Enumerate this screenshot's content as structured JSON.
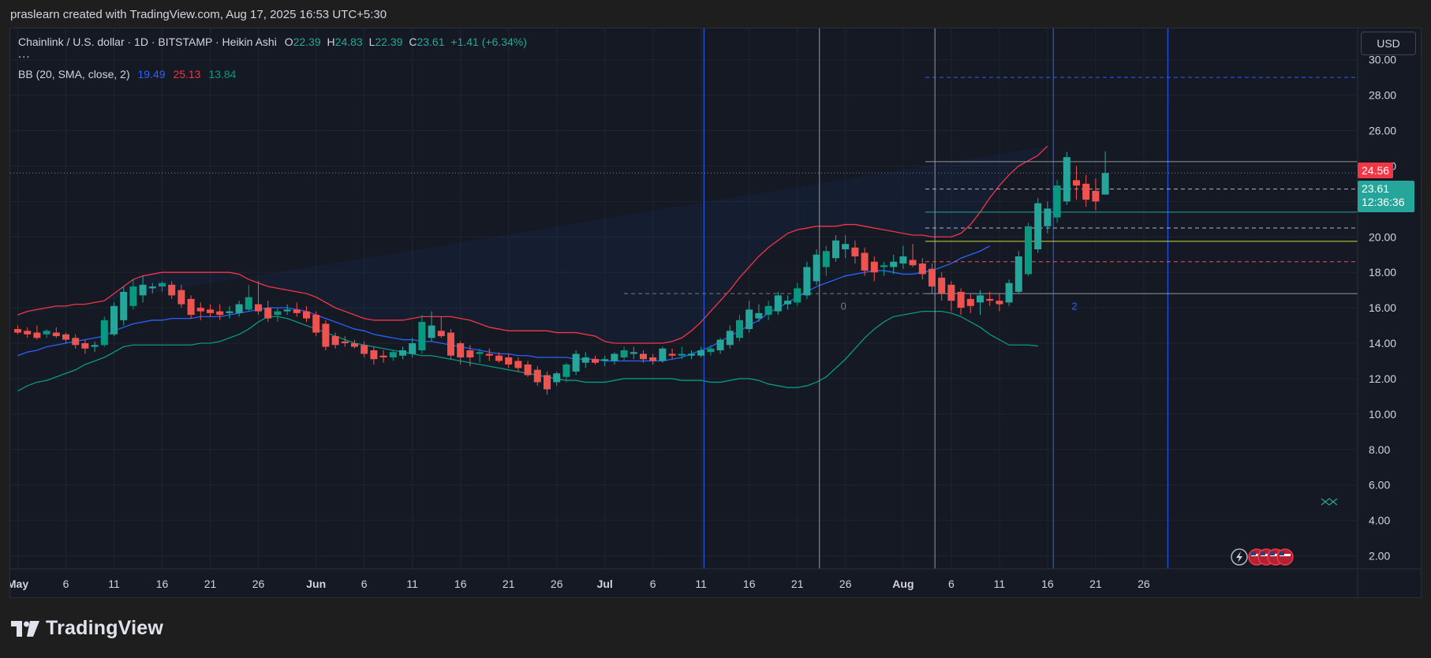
{
  "caption": "praslearn created with TradingView.com, Aug 17, 2025 16:53 UTC+5:30",
  "legend": {
    "symbol": "Chainlink / U.S. dollar · 1D · BITSTAMP · Heikin Ashi",
    "o_label": "O",
    "o": "22.39",
    "h_label": "H",
    "h": "24.83",
    "l_label": "L",
    "l": "22.39",
    "c_label": "C",
    "c": "23.61",
    "change": "+1.41 (+6.34%)",
    "more": "...",
    "bb_label": "BB (20, SMA, close, 2)",
    "bb_basis": "19.49",
    "bb_upper": "25.13",
    "bb_lower": "13.84"
  },
  "currency": "USD",
  "badges": {
    "upper": "24.56",
    "last_price": "23.61",
    "countdown": "12:36:36"
  },
  "footer": {
    "logo_text": "TradingView"
  },
  "colors": {
    "up": "#26a69a",
    "up_strong": "#089981",
    "down": "#ef5350",
    "bb_basis": "#2962ff",
    "bb_upper": "#f23645",
    "bb_lower": "#089981",
    "fill": "#2962ff"
  },
  "chart_data": {
    "type": "candlestick",
    "ylim": [
      1.0,
      31.5
    ],
    "y_ticks": [
      "30.00",
      "28.00",
      "26.00",
      "24.00",
      "22.00",
      "20.00",
      "18.00",
      "16.00",
      "14.00",
      "12.00",
      "10.00",
      "8.00",
      "6.00",
      "4.00",
      "2.00"
    ],
    "y_tick_values": [
      30,
      28,
      26,
      24,
      22,
      20,
      18,
      16,
      14,
      12,
      10,
      8,
      6,
      4,
      2
    ],
    "x_ticks": [
      {
        "label": "May",
        "day": 0
      },
      {
        "label": "6",
        "day": 5
      },
      {
        "label": "11",
        "day": 10
      },
      {
        "label": "16",
        "day": 15
      },
      {
        "label": "21",
        "day": 20
      },
      {
        "label": "26",
        "day": 25
      },
      {
        "label": "Jun",
        "day": 31
      },
      {
        "label": "6",
        "day": 36
      },
      {
        "label": "11",
        "day": 41
      },
      {
        "label": "16",
        "day": 46
      },
      {
        "label": "21",
        "day": 51
      },
      {
        "label": "26",
        "day": 56
      },
      {
        "label": "Jul",
        "day": 61
      },
      {
        "label": "6",
        "day": 66
      },
      {
        "label": "11",
        "day": 71
      },
      {
        "label": "16",
        "day": 76
      },
      {
        "label": "21",
        "day": 81
      },
      {
        "label": "26",
        "day": 86
      },
      {
        "label": "Aug",
        "day": 92
      },
      {
        "label": "6",
        "day": 97
      },
      {
        "label": "11",
        "day": 102
      },
      {
        "label": "16",
        "day": 107
      },
      {
        "label": "21",
        "day": 112
      },
      {
        "label": "26",
        "day": 117
      }
    ],
    "candles_ohlc": [
      [
        14.8,
        15.0,
        14.5,
        14.6
      ],
      [
        14.7,
        14.9,
        14.3,
        14.5
      ],
      [
        14.6,
        15.0,
        14.2,
        14.3
      ],
      [
        14.5,
        14.8,
        14.3,
        14.7
      ],
      [
        14.6,
        14.9,
        14.3,
        14.4
      ],
      [
        14.5,
        14.6,
        14.0,
        14.2
      ],
      [
        14.3,
        14.5,
        13.7,
        13.9
      ],
      [
        14.0,
        14.2,
        13.4,
        13.7
      ],
      [
        13.8,
        14.1,
        13.5,
        13.9
      ],
      [
        13.9,
        15.5,
        13.8,
        15.3
      ],
      [
        14.5,
        16.3,
        14.4,
        16.1
      ],
      [
        15.3,
        17.2,
        15.0,
        16.9
      ],
      [
        16.1,
        17.6,
        15.9,
        17.2
      ],
      [
        16.7,
        17.8,
        16.3,
        17.3
      ],
      [
        17.1,
        17.4,
        16.8,
        17.2
      ],
      [
        17.2,
        17.5,
        16.9,
        17.4
      ],
      [
        17.3,
        17.5,
        16.5,
        16.7
      ],
      [
        17.0,
        17.3,
        16.0,
        16.2
      ],
      [
        16.5,
        16.7,
        15.4,
        15.6
      ],
      [
        16.0,
        16.3,
        15.3,
        15.8
      ],
      [
        15.9,
        16.2,
        15.5,
        15.7
      ],
      [
        15.8,
        16.2,
        15.3,
        15.6
      ],
      [
        15.7,
        16.1,
        15.4,
        15.8
      ],
      [
        15.7,
        16.4,
        15.5,
        16.2
      ],
      [
        15.9,
        17.3,
        15.8,
        16.6
      ],
      [
        16.2,
        17.5,
        15.6,
        15.8
      ],
      [
        16.0,
        16.4,
        15.2,
        15.4
      ],
      [
        15.6,
        16.0,
        15.2,
        15.8
      ],
      [
        15.8,
        16.2,
        15.6,
        15.9
      ],
      [
        15.9,
        16.3,
        15.5,
        15.7
      ],
      [
        15.8,
        16.1,
        15.2,
        15.4
      ],
      [
        15.6,
        15.8,
        14.4,
        14.6
      ],
      [
        15.1,
        15.3,
        13.6,
        13.8
      ],
      [
        14.4,
        14.6,
        13.7,
        13.9
      ],
      [
        14.1,
        14.4,
        13.8,
        14.0
      ],
      [
        14.0,
        14.2,
        13.7,
        13.8
      ],
      [
        13.9,
        14.1,
        13.2,
        13.4
      ],
      [
        13.6,
        13.8,
        12.8,
        13.1
      ],
      [
        13.3,
        13.6,
        12.9,
        13.2
      ],
      [
        13.2,
        13.6,
        13.0,
        13.5
      ],
      [
        13.3,
        13.8,
        13.1,
        13.6
      ],
      [
        13.4,
        14.3,
        13.2,
        14.0
      ],
      [
        13.6,
        15.6,
        13.4,
        15.2
      ],
      [
        14.3,
        15.8,
        14.1,
        15.0
      ],
      [
        14.7,
        15.5,
        14.3,
        14.4
      ],
      [
        14.6,
        14.8,
        13.1,
        13.3
      ],
      [
        14.0,
        14.1,
        12.8,
        13.2
      ],
      [
        13.6,
        13.9,
        12.7,
        13.2
      ],
      [
        13.4,
        13.7,
        12.9,
        13.5
      ],
      [
        13.4,
        13.7,
        13.0,
        13.3
      ],
      [
        13.3,
        13.5,
        12.9,
        13.0
      ],
      [
        13.2,
        13.4,
        12.6,
        12.8
      ],
      [
        13.0,
        13.2,
        12.4,
        12.6
      ],
      [
        12.8,
        13.0,
        12.1,
        12.2
      ],
      [
        12.5,
        12.7,
        11.6,
        11.8
      ],
      [
        12.2,
        12.4,
        11.1,
        11.4
      ],
      [
        11.8,
        12.4,
        11.6,
        12.3
      ],
      [
        12.1,
        12.9,
        11.8,
        12.8
      ],
      [
        12.4,
        13.6,
        12.2,
        13.4
      ],
      [
        12.9,
        13.5,
        12.6,
        13.2
      ],
      [
        13.1,
        13.3,
        12.8,
        12.9
      ],
      [
        13.0,
        13.3,
        12.7,
        13.1
      ],
      [
        13.0,
        13.5,
        12.8,
        13.4
      ],
      [
        13.2,
        13.8,
        13.0,
        13.6
      ],
      [
        13.4,
        13.8,
        13.1,
        13.5
      ],
      [
        13.4,
        13.6,
        12.9,
        13.1
      ],
      [
        13.2,
        13.4,
        12.8,
        13.0
      ],
      [
        13.0,
        13.8,
        12.9,
        13.7
      ],
      [
        13.4,
        13.7,
        13.1,
        13.3
      ],
      [
        13.3,
        13.8,
        13.1,
        13.4
      ],
      [
        13.3,
        13.6,
        13.1,
        13.4
      ],
      [
        13.3,
        13.8,
        13.2,
        13.6
      ],
      [
        13.5,
        13.9,
        13.3,
        13.7
      ],
      [
        13.6,
        14.3,
        13.4,
        14.2
      ],
      [
        13.9,
        15.0,
        13.7,
        14.7
      ],
      [
        14.3,
        15.6,
        14.1,
        15.3
      ],
      [
        14.8,
        16.4,
        14.6,
        15.9
      ],
      [
        15.4,
        16.2,
        15.2,
        15.7
      ],
      [
        15.6,
        16.4,
        15.3,
        16.1
      ],
      [
        15.8,
        16.9,
        15.6,
        16.7
      ],
      [
        16.2,
        16.7,
        15.9,
        16.4
      ],
      [
        16.3,
        17.4,
        16.1,
        17.1
      ],
      [
        16.7,
        18.6,
        16.5,
        18.3
      ],
      [
        17.5,
        19.3,
        17.3,
        19.0
      ],
      [
        18.3,
        19.5,
        17.8,
        19.2
      ],
      [
        18.8,
        20.1,
        18.6,
        19.8
      ],
      [
        19.3,
        20.1,
        18.8,
        19.6
      ],
      [
        19.4,
        19.8,
        18.5,
        18.9
      ],
      [
        19.1,
        19.4,
        17.8,
        18.1
      ],
      [
        18.6,
        18.9,
        17.5,
        18.0
      ],
      [
        18.3,
        18.6,
        17.8,
        18.4
      ],
      [
        18.3,
        19.0,
        17.9,
        18.6
      ],
      [
        18.5,
        19.5,
        18.2,
        18.9
      ],
      [
        18.7,
        19.6,
        18.3,
        18.4
      ],
      [
        18.5,
        18.8,
        17.6,
        17.9
      ],
      [
        18.2,
        18.5,
        16.8,
        17.2
      ],
      [
        17.7,
        18.0,
        16.4,
        16.8
      ],
      [
        17.3,
        17.5,
        15.8,
        16.4
      ],
      [
        16.9,
        17.1,
        15.6,
        16.0
      ],
      [
        16.5,
        16.8,
        15.7,
        16.1
      ],
      [
        16.3,
        17.0,
        15.6,
        16.7
      ],
      [
        16.5,
        16.9,
        16.1,
        16.4
      ],
      [
        16.4,
        16.8,
        15.8,
        16.2
      ],
      [
        16.3,
        17.6,
        16.1,
        17.4
      ],
      [
        16.9,
        19.2,
        16.8,
        18.9
      ],
      [
        17.9,
        20.8,
        17.8,
        20.6
      ],
      [
        19.3,
        22.2,
        19.1,
        21.9
      ],
      [
        20.6,
        22.0,
        20.2,
        21.6
      ],
      [
        21.1,
        23.2,
        20.8,
        22.9
      ],
      [
        22.0,
        24.8,
        21.8,
        24.5
      ],
      [
        23.2,
        24.0,
        22.1,
        22.9
      ],
      [
        23.0,
        23.5,
        21.7,
        22.1
      ],
      [
        22.6,
        23.3,
        21.5,
        22.0
      ],
      [
        22.39,
        24.83,
        22.39,
        23.61
      ]
    ],
    "bb_upper": [
      15.6,
      15.8,
      15.9,
      16.0,
      16.1,
      16.1,
      16.2,
      16.2,
      16.3,
      16.4,
      16.8,
      17.2,
      17.6,
      17.8,
      17.9,
      18.0,
      18.0,
      18.0,
      18.0,
      18.0,
      18.0,
      18.0,
      18.0,
      17.9,
      17.6,
      17.4,
      17.2,
      17.1,
      17.0,
      16.9,
      16.8,
      16.6,
      16.3,
      16.0,
      15.8,
      15.6,
      15.4,
      15.3,
      15.3,
      15.3,
      15.3,
      15.4,
      15.5,
      15.5,
      15.5,
      15.5,
      15.4,
      15.3,
      15.1,
      14.9,
      14.8,
      14.7,
      14.7,
      14.7,
      14.7,
      14.7,
      14.6,
      14.6,
      14.6,
      14.5,
      14.4,
      14.1,
      14.0,
      14.0,
      14.0,
      14.0,
      14.0,
      14.0,
      14.1,
      14.3,
      14.7,
      15.2,
      15.8,
      16.4,
      17.0,
      17.7,
      18.3,
      18.9,
      19.4,
      19.8,
      20.2,
      20.4,
      20.5,
      20.6,
      20.6,
      20.6,
      20.7,
      20.7,
      20.6,
      20.5,
      20.4,
      20.3,
      20.2,
      20.1,
      20.1,
      20.0,
      20.0,
      20.0,
      20.2,
      20.7,
      21.4,
      22.2,
      22.9,
      23.5,
      24.0,
      24.3,
      24.6,
      25.13
    ],
    "bb_basis": [
      13.3,
      13.5,
      13.6,
      13.8,
      13.9,
      14.0,
      14.1,
      14.2,
      14.3,
      14.4,
      14.7,
      14.9,
      15.1,
      15.2,
      15.3,
      15.3,
      15.4,
      15.4,
      15.4,
      15.5,
      15.5,
      15.5,
      15.6,
      15.7,
      15.8,
      15.9,
      16.0,
      16.0,
      16.0,
      15.9,
      15.8,
      15.6,
      15.4,
      15.2,
      15.0,
      14.8,
      14.7,
      14.5,
      14.4,
      14.3,
      14.2,
      14.2,
      14.1,
      14.1,
      14.0,
      13.9,
      13.8,
      13.7,
      13.6,
      13.5,
      13.4,
      13.4,
      13.3,
      13.3,
      13.2,
      13.2,
      13.2,
      13.2,
      13.1,
      13.1,
      13.1,
      13.0,
      13.0,
      13.0,
      13.0,
      13.0,
      13.0,
      13.0,
      13.1,
      13.2,
      13.4,
      13.6,
      13.8,
      14.1,
      14.4,
      14.7,
      15.0,
      15.3,
      15.7,
      16.0,
      16.3,
      16.6,
      16.9,
      17.2,
      17.4,
      17.6,
      17.8,
      17.9,
      18.0,
      18.1,
      18.1,
      18.0,
      17.9,
      17.9,
      18.0,
      18.1,
      18.3,
      18.5,
      18.8,
      19.0,
      19.2,
      19.49
    ],
    "bb_lower": [
      11.3,
      11.6,
      11.8,
      11.9,
      12.1,
      12.3,
      12.5,
      12.8,
      13.0,
      13.2,
      13.5,
      13.8,
      13.9,
      13.9,
      13.9,
      13.9,
      13.9,
      13.9,
      13.9,
      14.0,
      14.0,
      14.1,
      14.3,
      14.5,
      14.8,
      15.2,
      15.5,
      15.5,
      15.4,
      15.2,
      15.0,
      14.8,
      14.6,
      14.4,
      14.2,
      14.0,
      13.9,
      13.8,
      13.7,
      13.6,
      13.5,
      13.4,
      13.3,
      13.3,
      13.2,
      13.1,
      13.0,
      12.9,
      12.8,
      12.7,
      12.6,
      12.5,
      12.4,
      12.3,
      12.2,
      12.1,
      12.0,
      11.9,
      11.9,
      11.8,
      11.8,
      11.8,
      11.9,
      12.0,
      12.0,
      12.0,
      12.0,
      12.0,
      12.0,
      11.9,
      11.9,
      11.9,
      11.8,
      11.8,
      11.9,
      12.0,
      12.0,
      11.9,
      11.7,
      11.6,
      11.5,
      11.5,
      11.6,
      11.8,
      12.1,
      12.6,
      13.1,
      13.7,
      14.3,
      14.8,
      15.2,
      15.5,
      15.6,
      15.7,
      15.8,
      15.8,
      15.8,
      15.7,
      15.5,
      15.2,
      14.9,
      14.5,
      14.2,
      13.9,
      13.9,
      13.9,
      13.84
    ],
    "vlines": [
      {
        "day": 71.3,
        "color": "#2962ff"
      },
      {
        "day": 83.3,
        "color": "#9598a1"
      },
      {
        "day": 95.3,
        "color": "#9598a1"
      },
      {
        "day": 107.6,
        "color": "#2962ff"
      },
      {
        "day": 119.5,
        "color": "#2962ff"
      }
    ],
    "hlines": [
      {
        "price": 29.0,
        "from_day": 94.3,
        "color": "#2962ff",
        "dash": true
      },
      {
        "price": 24.25,
        "from_day": 94.3,
        "color": "#9598a1",
        "dash": false
      },
      {
        "price": 22.7,
        "from_day": 94.3,
        "color": "#b2b5be",
        "dash": true
      },
      {
        "price": 21.4,
        "from_day": 94.3,
        "color": "#26a69a",
        "dash": false
      },
      {
        "price": 20.5,
        "from_day": 94.3,
        "color": "#b2b5be",
        "dash": true
      },
      {
        "price": 19.75,
        "from_day": 94.3,
        "color": "#cddc39",
        "dash": false
      },
      {
        "price": 18.6,
        "from_day": 94.3,
        "color": "#ef5350",
        "dash": true
      },
      {
        "price": 16.8,
        "from_day": 94.3,
        "color": "#9598a1",
        "dash": false
      },
      {
        "price": 16.8,
        "from_day": 63.0,
        "to_day": 94.3,
        "color": "#787b86",
        "dash": true
      }
    ],
    "annotations": [
      {
        "text": "0",
        "day": 85.5,
        "price": 15.9,
        "color": "#787b86"
      },
      {
        "text": "2",
        "day": 109.5,
        "price": 15.9,
        "color": "#2962ff"
      }
    ]
  }
}
